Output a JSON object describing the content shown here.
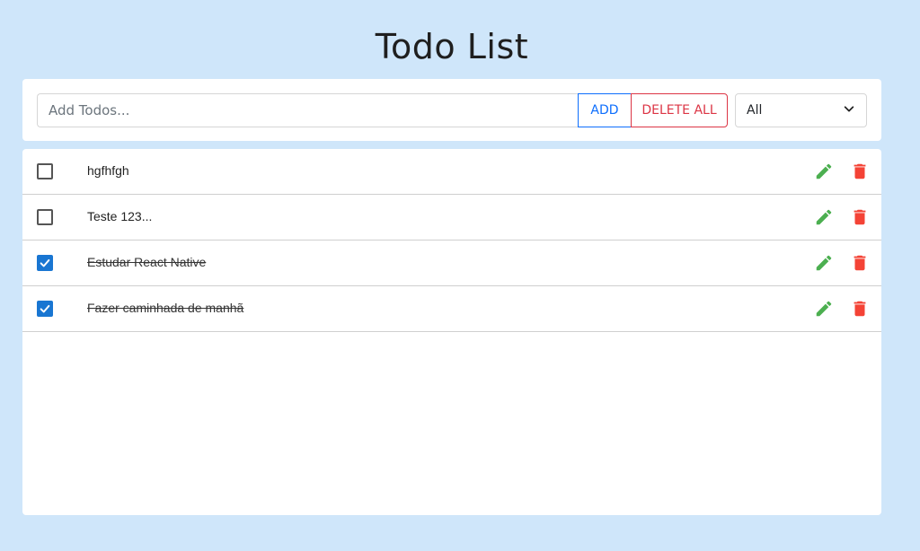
{
  "header": {
    "title": "Todo List"
  },
  "toolbar": {
    "input_placeholder": "Add Todos...",
    "input_value": "",
    "add_label": "ADD",
    "delete_all_label": "DELETE ALL",
    "filter_selected": "All"
  },
  "todos": [
    {
      "text": "hgfhfgh",
      "completed": false
    },
    {
      "text": "Teste 123...",
      "completed": false
    },
    {
      "text": "Estudar React Native",
      "completed": true
    },
    {
      "text": "Fazer caminhada de manhã",
      "completed": true
    }
  ],
  "icons": {
    "edit": "pencil-icon",
    "delete": "trash-icon",
    "filter": "chevron-down-icon",
    "check": "check-icon"
  },
  "colors": {
    "background": "#cfe6fa",
    "add_accent": "#0d6efd",
    "delete_accent": "#dc3545",
    "edit_icon": "#4caf50",
    "trash_icon": "#f44336",
    "checkbox_checked": "#1976d2"
  }
}
